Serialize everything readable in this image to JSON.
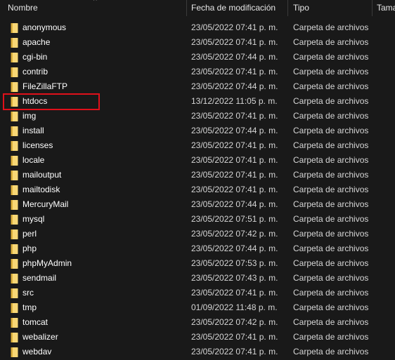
{
  "header": {
    "columns": [
      "Nombre",
      "Fecha de modificación",
      "Tipo",
      "Tama"
    ],
    "sort_glyph": "^"
  },
  "icons": {
    "folder": "folder-icon",
    "sort": "sort-ascending-icon"
  },
  "colors": {
    "background": "#191919",
    "folder": "#f8d775",
    "folder_shadow": "#dcae3a",
    "highlight": "#e0101a"
  },
  "highlighted_row": "htdocs",
  "rows": [
    {
      "name": "anonymous",
      "date": "23/05/2022 07:41 p. m.",
      "type": "Carpeta de archivos"
    },
    {
      "name": "apache",
      "date": "23/05/2022 07:41 p. m.",
      "type": "Carpeta de archivos"
    },
    {
      "name": "cgi-bin",
      "date": "23/05/2022 07:44 p. m.",
      "type": "Carpeta de archivos"
    },
    {
      "name": "contrib",
      "date": "23/05/2022 07:41 p. m.",
      "type": "Carpeta de archivos"
    },
    {
      "name": "FileZillaFTP",
      "date": "23/05/2022 07:44 p. m.",
      "type": "Carpeta de archivos"
    },
    {
      "name": "htdocs",
      "date": "13/12/2022 11:05 p. m.",
      "type": "Carpeta de archivos"
    },
    {
      "name": "img",
      "date": "23/05/2022 07:41 p. m.",
      "type": "Carpeta de archivos"
    },
    {
      "name": "install",
      "date": "23/05/2022 07:44 p. m.",
      "type": "Carpeta de archivos"
    },
    {
      "name": "licenses",
      "date": "23/05/2022 07:41 p. m.",
      "type": "Carpeta de archivos"
    },
    {
      "name": "locale",
      "date": "23/05/2022 07:41 p. m.",
      "type": "Carpeta de archivos"
    },
    {
      "name": "mailoutput",
      "date": "23/05/2022 07:41 p. m.",
      "type": "Carpeta de archivos"
    },
    {
      "name": "mailtodisk",
      "date": "23/05/2022 07:41 p. m.",
      "type": "Carpeta de archivos"
    },
    {
      "name": "MercuryMail",
      "date": "23/05/2022 07:44 p. m.",
      "type": "Carpeta de archivos"
    },
    {
      "name": "mysql",
      "date": "23/05/2022 07:51 p. m.",
      "type": "Carpeta de archivos"
    },
    {
      "name": "perl",
      "date": "23/05/2022 07:42 p. m.",
      "type": "Carpeta de archivos"
    },
    {
      "name": "php",
      "date": "23/05/2022 07:44 p. m.",
      "type": "Carpeta de archivos"
    },
    {
      "name": "phpMyAdmin",
      "date": "23/05/2022 07:53 p. m.",
      "type": "Carpeta de archivos"
    },
    {
      "name": "sendmail",
      "date": "23/05/2022 07:43 p. m.",
      "type": "Carpeta de archivos"
    },
    {
      "name": "src",
      "date": "23/05/2022 07:41 p. m.",
      "type": "Carpeta de archivos"
    },
    {
      "name": "tmp",
      "date": "01/09/2022 11:48 p. m.",
      "type": "Carpeta de archivos"
    },
    {
      "name": "tomcat",
      "date": "23/05/2022 07:42 p. m.",
      "type": "Carpeta de archivos"
    },
    {
      "name": "webalizer",
      "date": "23/05/2022 07:41 p. m.",
      "type": "Carpeta de archivos"
    },
    {
      "name": "webdav",
      "date": "23/05/2022 07:41 p. m.",
      "type": "Carpeta de archivos"
    }
  ]
}
